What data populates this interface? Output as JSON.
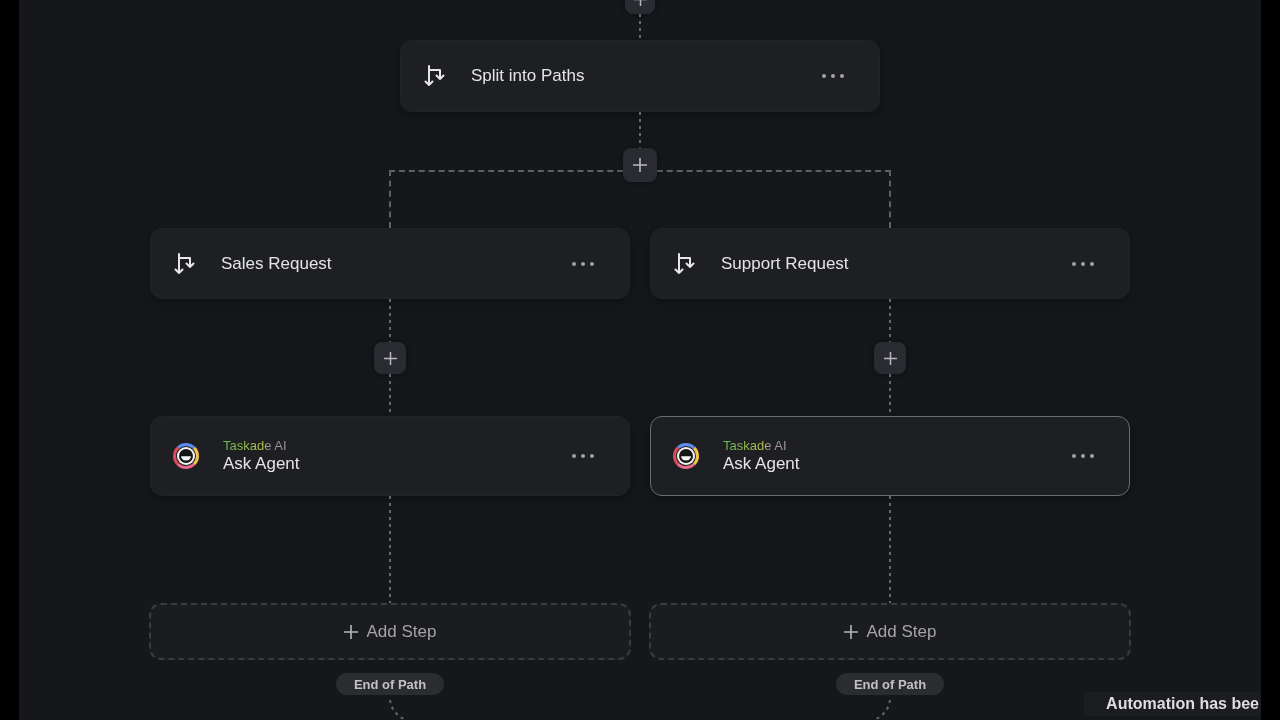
{
  "canvas": {
    "split_node": {
      "kind": "split",
      "title": "Split into Paths",
      "selected": false
    },
    "paths": [
      {
        "nodes": [
          {
            "kind": "condition",
            "title": "Sales Request",
            "selected": false
          },
          {
            "kind": "agent",
            "provider": "Taskade AI",
            "title": "Ask Agent",
            "selected": false
          }
        ],
        "add_step": "Add Step",
        "end_label": "End of Path"
      },
      {
        "nodes": [
          {
            "kind": "condition",
            "title": "Support Request",
            "selected": false
          },
          {
            "kind": "agent",
            "provider": "Taskade AI",
            "title": "Ask Agent",
            "selected": true
          }
        ],
        "add_step": "Add Step",
        "end_label": "End of Path"
      }
    ]
  },
  "toast": {
    "message": "Automation has bee"
  }
}
